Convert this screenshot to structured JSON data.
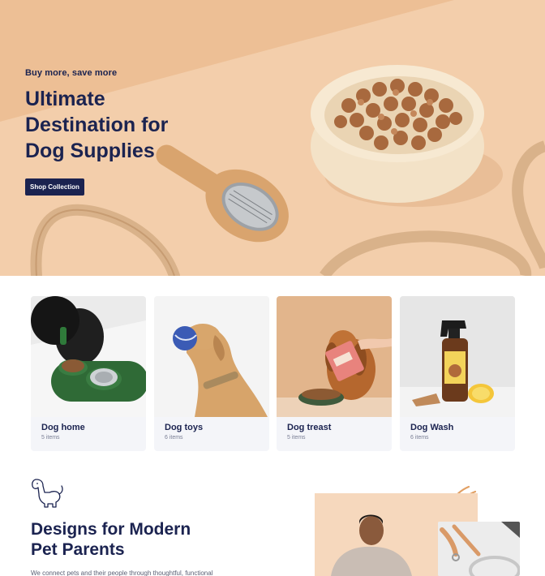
{
  "hero": {
    "eyebrow": "Buy more, save more",
    "title_lines": [
      "Ultimate",
      "Destination for",
      "Dog Supplies"
    ],
    "cta_label": "Shop Collection"
  },
  "categories": [
    {
      "name": "Dog home",
      "count": "5 items"
    },
    {
      "name": "Dog toys",
      "count": "6 items"
    },
    {
      "name": "Dog treast",
      "count": "5 items"
    },
    {
      "name": "Dog Wash",
      "count": "6 items"
    }
  ],
  "section": {
    "title_lines": [
      "Designs for Modern",
      "Pet Parents"
    ],
    "description": "We connect pets and their people through thoughtful, functional"
  },
  "colors": {
    "navy": "#1b2350",
    "hero_peach": "#f0c9a4",
    "card_bg": "#f4f5f9"
  },
  "icons": [
    "dog-outline-icon"
  ]
}
